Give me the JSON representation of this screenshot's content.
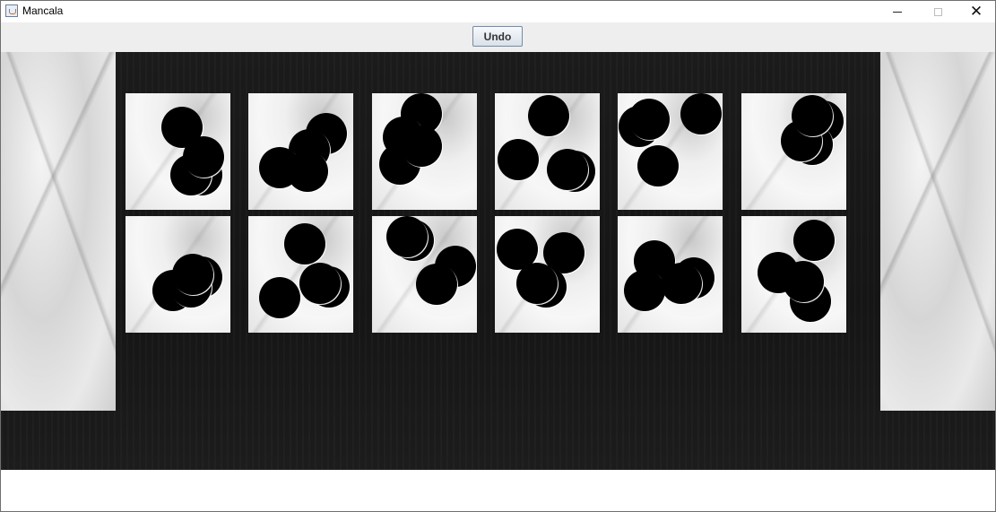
{
  "window": {
    "title": "Mancala",
    "icon": "java-coffee-cup-icon",
    "controls": [
      "minimize-icon",
      "maximize-icon",
      "close-icon"
    ]
  },
  "toolbar": {
    "undo_label": "Undo"
  },
  "board": {
    "top_row_stones": [
      4,
      4,
      4,
      4,
      4,
      4
    ],
    "bottom_row_stones": [
      4,
      4,
      4,
      4,
      4,
      4
    ],
    "left_store_stones": 0,
    "right_store_stones": 0
  }
}
